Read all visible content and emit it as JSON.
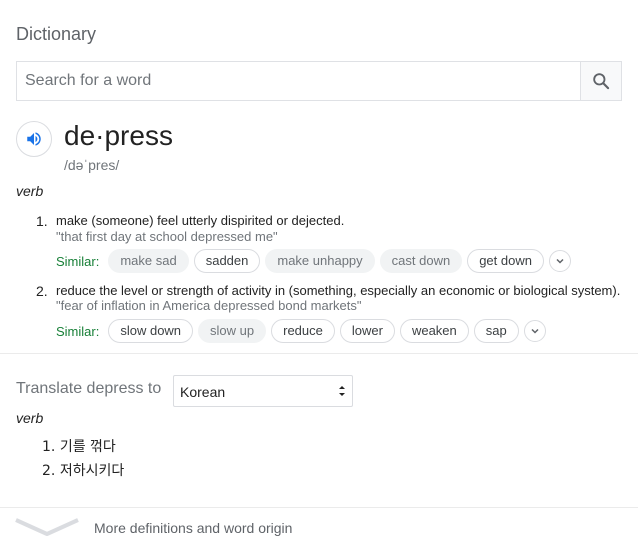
{
  "panel": {
    "title": "Dictionary"
  },
  "search": {
    "placeholder": "Search for a word",
    "button_icon": "search-icon"
  },
  "entry": {
    "word": "de·press",
    "phonetic": "/dəˈpres/",
    "pronounce_icon": "speaker-icon",
    "part_of_speech": "verb",
    "senses": [
      {
        "number": "1.",
        "definition": "make (someone) feel utterly dispirited or dejected.",
        "example": "\"that first day at school depressed me\"",
        "similar_label": "Similar:",
        "similar": [
          "make sad",
          "sadden",
          "make unhappy",
          "cast down",
          "get down"
        ]
      },
      {
        "number": "2.",
        "definition": "reduce the level or strength of activity in (something, especially an economic or biological system).",
        "example": "\"fear of inflation in America depressed bond markets\"",
        "similar_label": "Similar:",
        "similar": [
          "slow down",
          "slow up",
          "reduce",
          "lower",
          "weaken",
          "sap"
        ]
      }
    ]
  },
  "translate": {
    "label": "Translate depress to",
    "language": "Korean",
    "part_of_speech": "verb",
    "items": [
      {
        "number": "1.",
        "text": "기를 꺾다"
      },
      {
        "number": "2.",
        "text": "저하시키다"
      }
    ]
  },
  "footer": {
    "more_label": "More definitions and word origin"
  },
  "colors": {
    "similar_label": "#188038",
    "speaker_icon": "#1a73e8",
    "muted_text": "#70757a"
  }
}
